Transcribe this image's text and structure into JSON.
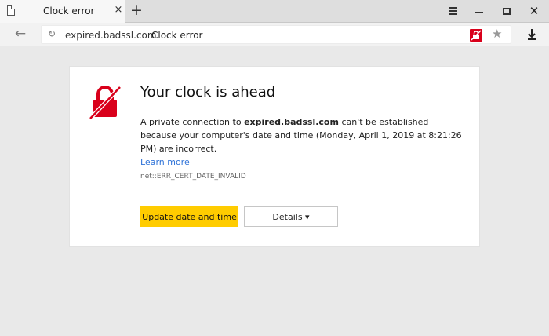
{
  "tab": {
    "title": "Clock error",
    "close_glyph": "×",
    "new_tab_glyph": "+"
  },
  "window_controls": {
    "menu_icon": "hamburger-icon",
    "minimize_icon": "minimize-icon",
    "maximize_icon": "maximize-icon",
    "close_glyph": "✕"
  },
  "toolbar": {
    "back_glyph": "←",
    "reload_glyph": "↻",
    "url_domain": "expired.badssl.com",
    "url_title": "Clock error",
    "star_glyph": "★",
    "security_icon": "cert-error-icon",
    "download_icon": "download-icon"
  },
  "error": {
    "heading": "Your clock is ahead",
    "desc_prefix": "A private connection to ",
    "domain": "expired.badssl.com",
    "desc_suffix": " can't be established because your computer's date and time (Monday, April 1, 2019 at 8:21:26 PM) are incorrect.",
    "learn_more": "Learn more",
    "code": "net::ERR_CERT_DATE_INVALID",
    "primary_button": "Update date and time",
    "details_button": "Details ▾"
  },
  "colors": {
    "accent_yellow": "#ffcc00",
    "error_red": "#d9001b",
    "link_blue": "#2f73d8"
  }
}
